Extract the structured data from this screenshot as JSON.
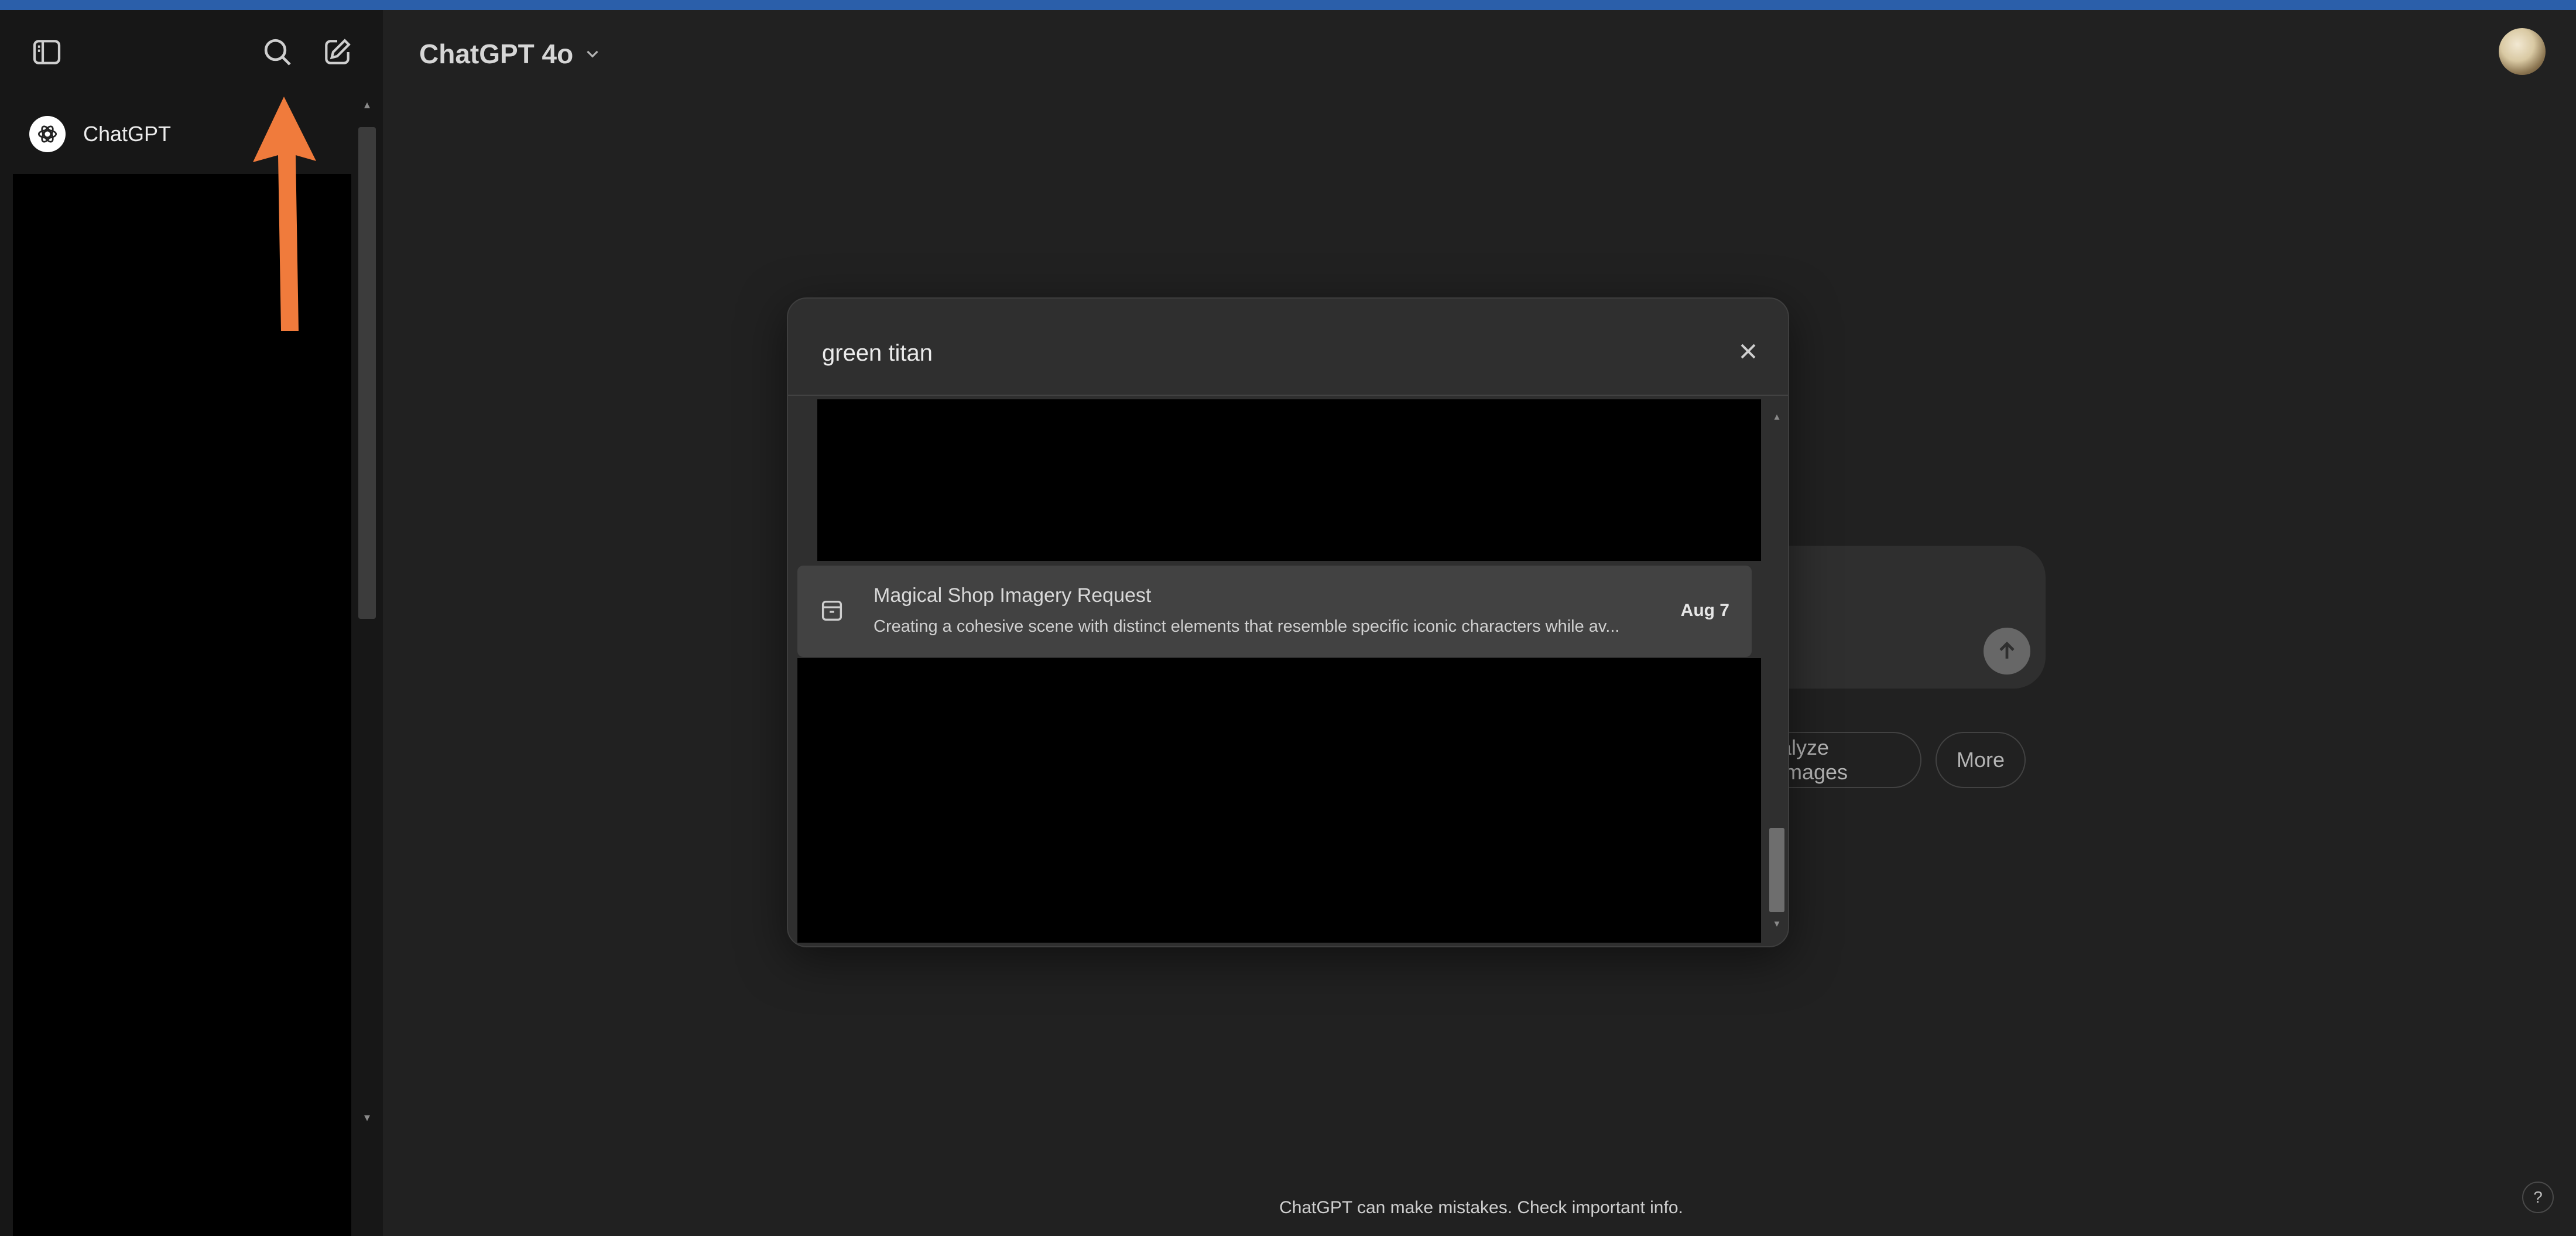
{
  "header": {
    "model_name": "ChatGPT 4o"
  },
  "sidebar": {
    "gpt_item_label": "ChatGPT",
    "icons": [
      "sidebar-toggle-icon",
      "search-icon",
      "new-chat-icon"
    ]
  },
  "search_modal": {
    "query": "green titan",
    "result": {
      "title": "Magical Shop Imagery Request",
      "snippet": "Creating a cohesive scene with distinct elements that resemble specific iconic characters while av...",
      "date": "Aug 7"
    }
  },
  "suggestions": {
    "analyze_label": "alyze images",
    "more_label": "More"
  },
  "footer": {
    "disclaimer": "ChatGPT can make mistakes. Check important info.",
    "help_label": "?"
  },
  "colors": {
    "annotation_arrow": "#f07b3c",
    "top_strip": "#2b5faa"
  }
}
